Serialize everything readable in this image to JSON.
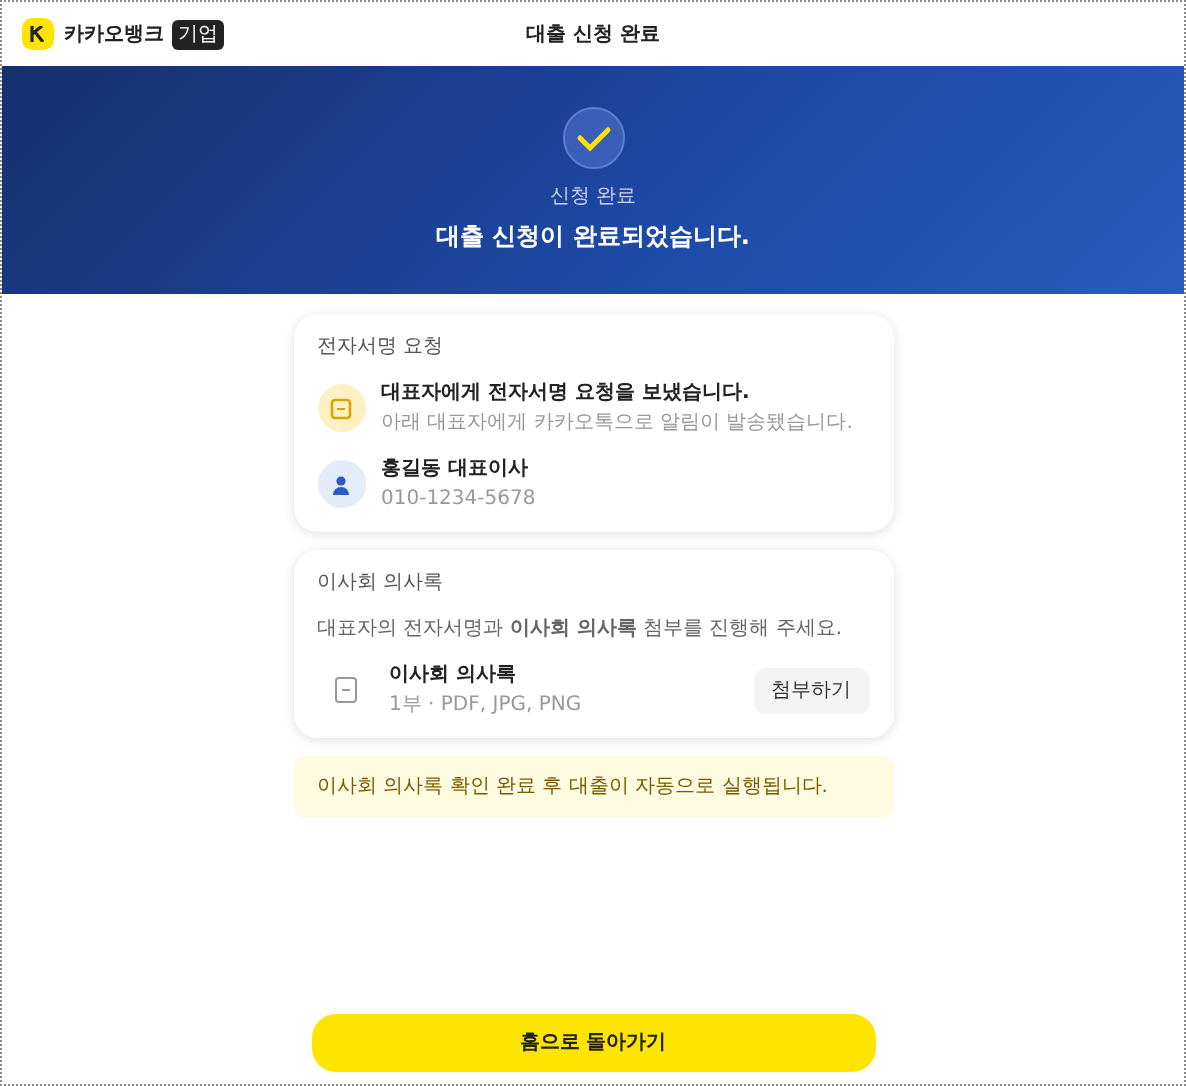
{
  "header": {
    "brand": "카카오뱅크",
    "badge": "기업",
    "title": "대출 신청 완료"
  },
  "hero": {
    "caption": "신청 완료",
    "headline": "대출 신청이 완료되었습니다."
  },
  "signature_card": {
    "title": "전자서명 요청",
    "message": "대표자에게 전자서명 요청을 보냈습니다.",
    "detail": "아래 대표자에게 카카오톡으로 알림이 발송됐습니다.",
    "signer": {
      "name": "홍길동 대표이사",
      "phone": "010-1234-5678"
    }
  },
  "minutes_card": {
    "title": "이사회 의사록",
    "instruction": "대표자의 전자서명과 **이사회 의사록** 첨부를 진행해 주세요.",
    "file": {
      "name": "이사회 의사록",
      "formats": "1부 · PDF, JPG, PNG"
    },
    "button": "첨부하기"
  },
  "notice": "이사회 의사록 확인 완료 후 대출이 자동으로 실행됩니다.",
  "home_button": "홈으로 돌아가기"
}
